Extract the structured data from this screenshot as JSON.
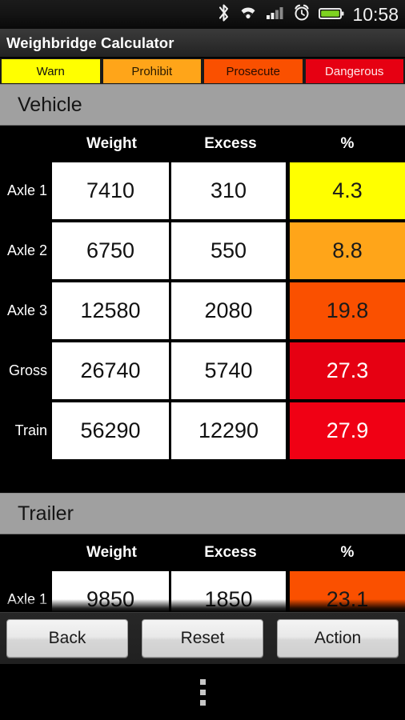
{
  "status_bar": {
    "icons": [
      "bluetooth-icon",
      "wifi-icon",
      "signal-icon",
      "alarm-icon",
      "battery-icon"
    ],
    "clock": "10:58"
  },
  "title_bar": {
    "title": "Weighbridge Calculator"
  },
  "legend": {
    "items": [
      {
        "label": "Warn",
        "color": "#ffff00"
      },
      {
        "label": "Prohibit",
        "color": "#ffa519"
      },
      {
        "label": "Prosecute",
        "color": "#fa5000"
      },
      {
        "label": "Dangerous",
        "color": "#e60012"
      }
    ]
  },
  "columns": {
    "label": "",
    "weight": "Weight",
    "excess": "Excess",
    "percent": "%"
  },
  "sections": [
    {
      "title": "Vehicle",
      "rows": [
        {
          "label": "Axle 1",
          "weight": "7410",
          "excess": "310",
          "percent": "4.3",
          "color": "#ffff00",
          "text": "dark"
        },
        {
          "label": "Axle 2",
          "weight": "6750",
          "excess": "550",
          "percent": "8.8",
          "color": "#ffa519",
          "text": "dark"
        },
        {
          "label": "Axle 3",
          "weight": "12580",
          "excess": "2080",
          "percent": "19.8",
          "color": "#fa5000",
          "text": "dark"
        },
        {
          "label": "Gross",
          "weight": "26740",
          "excess": "5740",
          "percent": "27.3",
          "color": "#e60012",
          "text": "light"
        },
        {
          "label": "Train",
          "weight": "56290",
          "excess": "12290",
          "percent": "27.9",
          "color": "#f00014",
          "text": "light"
        }
      ]
    },
    {
      "title": "Trailer",
      "rows": [
        {
          "label": "Axle 1",
          "weight": "9850",
          "excess": "1850",
          "percent": "23.1",
          "color": "#fa5000",
          "text": "dark"
        }
      ]
    }
  ],
  "buttons": [
    {
      "label": "Back"
    },
    {
      "label": "Reset"
    },
    {
      "label": "Action"
    }
  ],
  "nav_bar": {
    "menu": "overflow-menu"
  }
}
